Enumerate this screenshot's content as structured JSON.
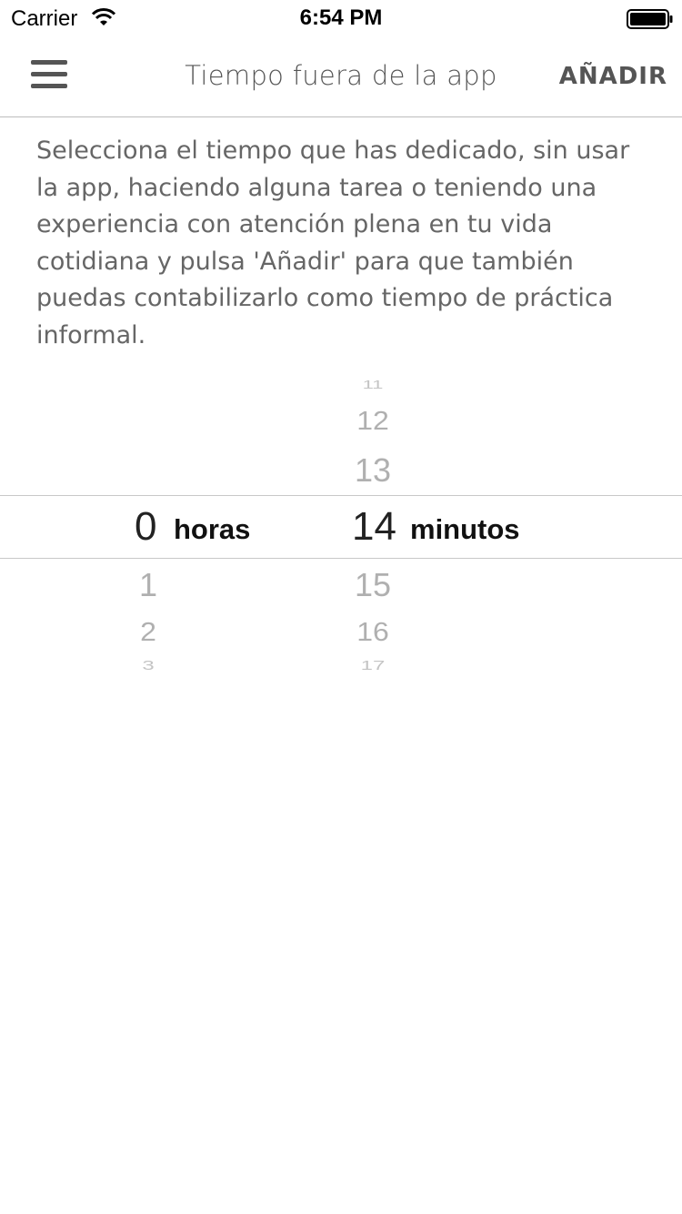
{
  "status_bar": {
    "carrier": "Carrier",
    "time": "6:54 PM"
  },
  "nav": {
    "title": "Tiempo fuera de la app",
    "add_label": "AÑADIR"
  },
  "instructions": "Selecciona el tiempo que has dedicado, sin usar la app, haciendo alguna tarea o teniendo una experiencia con atención plena en tu vida cotidiana y pulsa 'Añadir' para que también puedas contabilizarlo como tiempo de práctica informal.",
  "picker": {
    "hours": {
      "selected": "0",
      "unit": "horas",
      "after": [
        "1",
        "2",
        "3"
      ]
    },
    "minutes": {
      "before": [
        "11",
        "12",
        "13"
      ],
      "selected": "14",
      "unit": "minutos",
      "after": [
        "15",
        "16",
        "17"
      ]
    }
  },
  "colors": {
    "text": "#555555",
    "picker_faded": "#b0b0b0",
    "separator": "#c8c8c8"
  }
}
